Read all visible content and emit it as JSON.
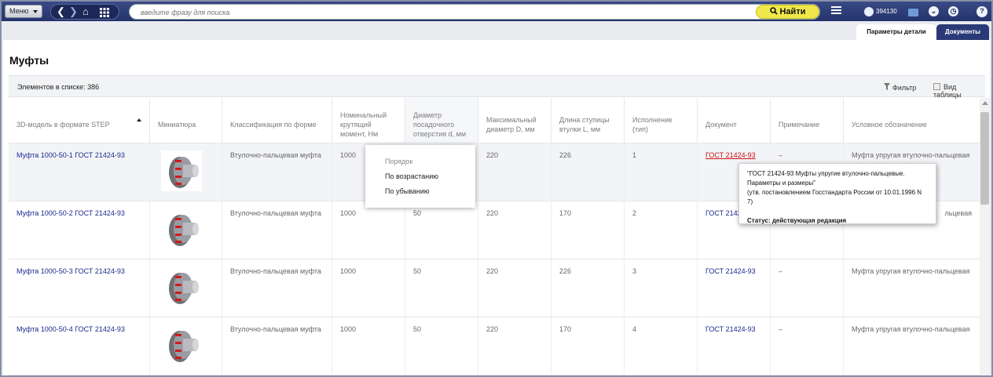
{
  "topbar": {
    "menu_label": "Меню",
    "search_placeholder": "введите фразу для поиска",
    "find_label": "Найти",
    "user_count": "394130"
  },
  "tabs": [
    {
      "label": "Параметры детали"
    },
    {
      "label": "Документы"
    }
  ],
  "page_title": "Муфты",
  "listbar": {
    "count_label": "Элементов в списке: 386",
    "filter_label": "Фильтр",
    "view_table_label": "Вид таблицы"
  },
  "columns": [
    "3D-модель в формате STEP",
    "Миниатюра",
    "Классификация по форме",
    "Номинальный крутящий момент, Нм",
    "Диаметр посадочного отверстия d, мм",
    "Максимальный диаметр D, мм",
    "Длина ступицы втулки L, мм",
    "Исполнение (тип)",
    "Документ",
    "Примечание",
    "Условное обозначение"
  ],
  "rows": [
    {
      "model": "Муфта 1000-50-1 ГОСТ 21424-93",
      "shape": "Втулочно-пальцевая муфта",
      "torque": "1000",
      "d": "",
      "D": "220",
      "L": "226",
      "type": "1",
      "doc": "ГОСТ 21424-93",
      "note": "–",
      "designation": "Муфта упругая втулочно-пальцевая"
    },
    {
      "model": "Муфта 1000-50-2 ГОСТ 21424-93",
      "shape": "Втулочно-пальцевая муфта",
      "torque": "1000",
      "d": "50",
      "D": "220",
      "L": "170",
      "type": "2",
      "doc": "ГОСТ 2142",
      "note": "",
      "designation": "льцевая"
    },
    {
      "model": "Муфта 1000-50-3 ГОСТ 21424-93",
      "shape": "Втулочно-пальцевая муфта",
      "torque": "1000",
      "d": "50",
      "D": "220",
      "L": "226",
      "type": "3",
      "doc": "ГОСТ 21424-93",
      "note": "–",
      "designation": "Муфта упругая втулочно-пальцевая"
    },
    {
      "model": "Муфта 1000-50-4 ГОСТ 21424-93",
      "shape": "Втулочно-пальцевая муфта",
      "torque": "1000",
      "d": "50",
      "D": "220",
      "L": "170",
      "type": "4",
      "doc": "ГОСТ 21424-93",
      "note": "–",
      "designation": "Муфта упругая втулочно-пальцевая"
    }
  ],
  "sort_menu": {
    "title": "Порядок",
    "asc": "По возрастанию",
    "desc": "По убыванию"
  },
  "tooltip": {
    "line1": "\"ГОСТ 21424-93 Муфты упругие втулочно-пальцевые.",
    "line2": "Параметры и размеры\"",
    "line3": "(утв. постановлением Госстандарта России от 10.01.1996 N 7)",
    "status": "Статус: действующая редакция"
  },
  "colors": {
    "topbar": "#2b3a75",
    "find_button": "#f0e84a",
    "link": "#1a2a8c",
    "doc_hover": "#cc1111"
  }
}
